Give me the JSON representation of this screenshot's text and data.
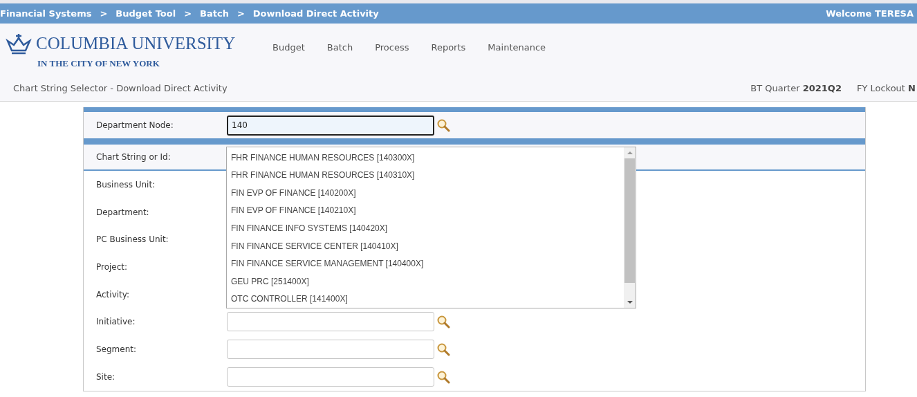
{
  "breadcrumb": [
    {
      "label": "Financial Systems",
      "separator": ">"
    },
    {
      "label": "Budget Tool",
      "separator": ">"
    },
    {
      "label": "Batch",
      "separator": ">"
    },
    {
      "label": "Download Direct Activity"
    }
  ],
  "welcome": "Welcome TERESA",
  "logo": {
    "name": "COLUMBIA UNIVERSITY",
    "subtitle": "IN THE CITY OF NEW YORK"
  },
  "nav": [
    "Budget",
    "Batch",
    "Process",
    "Reports",
    "Maintenance"
  ],
  "page_title": "Chart String Selector - Download Direct Activity",
  "status": [
    {
      "label": "BT Quarter",
      "value": "2021Q2"
    },
    {
      "label": "FY Lockout",
      "value": "N"
    }
  ],
  "form": {
    "node_row": {
      "label": "Department Node:",
      "field": {
        "value": "140",
        "focused": true
      }
    },
    "chart_row": {
      "label": "Chart String or Id:"
    },
    "rows": [
      {
        "label": "Business Unit:"
      },
      {
        "label": "Department:"
      },
      {
        "label": "PC Business Unit:"
      },
      {
        "label": "Project:"
      },
      {
        "label": "Activity:"
      },
      {
        "label": "Initiative:",
        "kind": "field"
      },
      {
        "label": "Segment:",
        "kind": "field"
      },
      {
        "label": "Site:",
        "kind": "field"
      }
    ]
  },
  "dropdown": {
    "options": [
      "FHR FINANCE HUMAN RESOURCES [140300X]",
      "FHR FINANCE HUMAN RESOURCES [140310X]",
      "FIN EVP OF FINANCE [140200X]",
      "FIN EVP OF FINANCE [140210X]",
      "FIN FINANCE INFO SYSTEMS [140420X]",
      "FIN FINANCE SERVICE CENTER [140410X]",
      "FIN FINANCE SERVICE MANAGEMENT [140400X]",
      "GEU PRC [251400X]",
      "OTC CONTROLLER [141400X]"
    ]
  }
}
